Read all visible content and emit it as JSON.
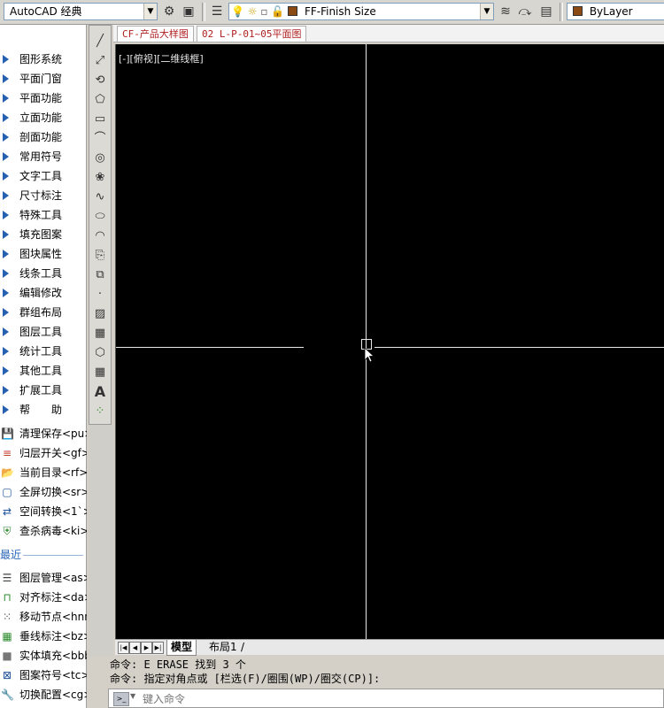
{
  "toolbar": {
    "workspace": "AutoCAD 经典",
    "layer": "FF-Finish Size",
    "color": "ByLayer",
    "brand_color": "#8b4a14"
  },
  "palette": {
    "groups": [
      {
        "label": "图形系统"
      },
      {
        "label": "平面门窗"
      },
      {
        "label": "平面功能"
      },
      {
        "label": "立面功能"
      },
      {
        "label": "剖面功能"
      },
      {
        "label": "常用符号"
      },
      {
        "label": "文字工具"
      },
      {
        "label": "尺寸标注"
      },
      {
        "label": "特殊工具"
      },
      {
        "label": "填充图案"
      },
      {
        "label": "图块属性"
      },
      {
        "label": "线条工具"
      },
      {
        "label": "编辑修改"
      },
      {
        "label": "群组布局"
      },
      {
        "label": "图层工具"
      },
      {
        "label": "统计工具"
      },
      {
        "label": "其他工具"
      },
      {
        "label": "扩展工具"
      },
      {
        "label": "帮　　助"
      }
    ],
    "commands": [
      {
        "label": "清理保存<pu>",
        "icon": "save-icon"
      },
      {
        "label": "归层开关<gf>",
        "icon": "layers-icon"
      },
      {
        "label": "当前目录<rf>",
        "icon": "folder-dwg-icon"
      },
      {
        "label": "全屏切换<sr>",
        "icon": "fullscreen-icon"
      },
      {
        "label": "空间转换<1`>",
        "icon": "space-icon"
      },
      {
        "label": "查杀病毒<ki>",
        "icon": "shield-icon"
      }
    ],
    "recent_label": "最近",
    "recent": [
      {
        "label": "图层管理<as>",
        "icon": "layer-manager-icon"
      },
      {
        "label": "对齐标注<da>",
        "icon": "align-dimension-icon"
      },
      {
        "label": "移动节点<hnn",
        "icon": "move-node-icon"
      },
      {
        "label": "垂线标注<bz>",
        "icon": "perpendicular-icon"
      },
      {
        "label": "实体填充<bbb",
        "icon": "solid-fill-icon"
      },
      {
        "label": "图案符号<tc>",
        "icon": "pattern-icon"
      },
      {
        "label": "切换配置<cg>",
        "icon": "wrench-icon"
      }
    ]
  },
  "file_tabs": [
    {
      "label": "CF-产品大样图"
    },
    {
      "label": "02 L-P-01~05平面图"
    }
  ],
  "viewport_label": "[-][俯视][二维线框]",
  "layout_tabs": {
    "model": "模型",
    "layout1": "布局1"
  },
  "command": {
    "history": [
      "命令: E ERASE 找到 3 个",
      "命令: 指定对角点或 [栏选(F)/圈围(WP)/圈交(CP)]:"
    ],
    "placeholder": "键入命令"
  }
}
